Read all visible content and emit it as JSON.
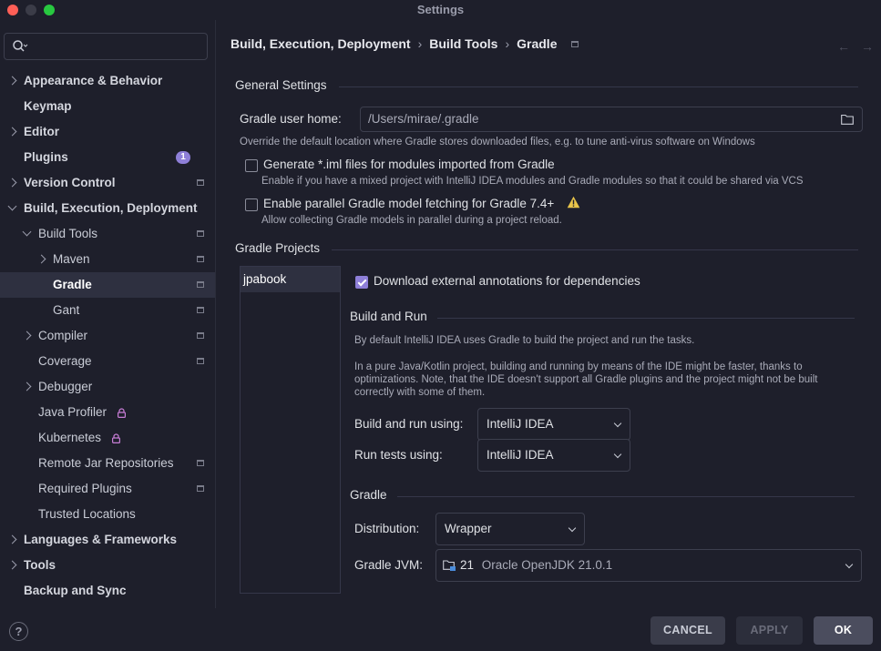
{
  "window": {
    "title": "Settings"
  },
  "search": {
    "placeholder": ""
  },
  "sidebar": {
    "items": [
      {
        "label": "Appearance & Behavior"
      },
      {
        "label": "Keymap"
      },
      {
        "label": "Editor"
      },
      {
        "label": "Plugins",
        "badge": "1"
      },
      {
        "label": "Version Control"
      },
      {
        "label": "Build, Execution, Deployment"
      },
      {
        "label": "Build Tools"
      },
      {
        "label": "Maven"
      },
      {
        "label": "Gradle"
      },
      {
        "label": "Gant"
      },
      {
        "label": "Compiler"
      },
      {
        "label": "Coverage"
      },
      {
        "label": "Debugger"
      },
      {
        "label": "Java Profiler"
      },
      {
        "label": "Kubernetes"
      },
      {
        "label": "Remote Jar Repositories"
      },
      {
        "label": "Required Plugins"
      },
      {
        "label": "Trusted Locations"
      },
      {
        "label": "Languages & Frameworks"
      },
      {
        "label": "Tools"
      },
      {
        "label": "Backup and Sync"
      }
    ],
    "help": "?"
  },
  "breadcrumb": {
    "level1": "Build, Execution, Deployment",
    "level2": "Build Tools",
    "level3": "Gradle",
    "sep": "›"
  },
  "nav": {
    "back": "←",
    "forward": "→"
  },
  "general": {
    "title": "General Settings",
    "user_home_label": "Gradle user home:",
    "user_home_value": "/Users/mirae/.gradle",
    "user_home_hint": "Override the default location where Gradle stores downloaded files, e.g. to tune anti-virus software on Windows",
    "iml_label": "Generate *.iml files for modules imported from Gradle",
    "iml_hint": "Enable if you have a mixed project with IntelliJ IDEA modules and Gradle modules so that it could be shared via VCS",
    "iml_checked": false,
    "parallel_label": "Enable parallel Gradle model fetching for Gradle 7.4+",
    "parallel_hint": "Allow collecting Gradle models in parallel during a project reload.",
    "parallel_checked": false
  },
  "projects": {
    "title": "Gradle Projects",
    "items": [
      "jpabook"
    ],
    "download_annotations_label": "Download external annotations for dependencies",
    "download_annotations_checked": true
  },
  "build_run": {
    "title": "Build and Run",
    "desc1": "By default IntelliJ IDEA uses Gradle to build the project and run the tasks.",
    "desc2": "In a pure Java/Kotlin project, building and running by means of the IDE might be faster, thanks to optimizations. Note, that the IDE doesn't support all Gradle plugins and the project might not be built correctly with some of them.",
    "build_using_label": "Build and run using:",
    "build_using_value": "IntelliJ IDEA",
    "tests_using_label": "Run tests using:",
    "tests_using_value": "IntelliJ IDEA"
  },
  "gradle": {
    "title": "Gradle",
    "distribution_label": "Distribution:",
    "distribution_value": "Wrapper",
    "jvm_label": "Gradle JVM:",
    "jvm_version": "21",
    "jvm_name": "Oracle OpenJDK 21.0.1"
  },
  "footer": {
    "cancel": "CANCEL",
    "apply": "APPLY",
    "ok": "OK"
  },
  "colors": {
    "background": "#1e1f2b",
    "accent": "#8e7fd8",
    "selection": "#2e3040",
    "warning": "#e8c44a"
  }
}
